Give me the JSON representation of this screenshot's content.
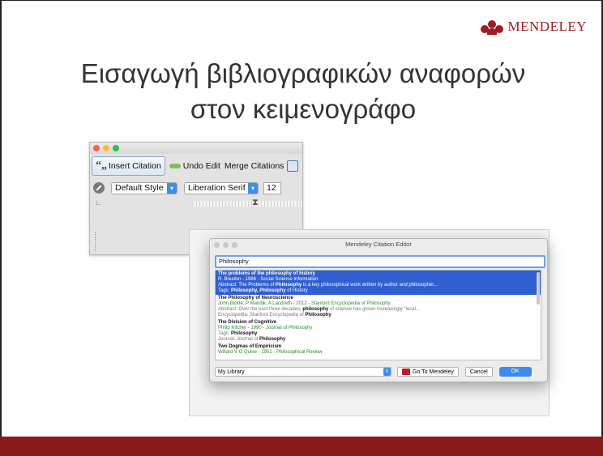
{
  "brand": {
    "name": "MENDELEY",
    "color": "#9e1c22",
    "logo_icon": "mendeley-people-icon"
  },
  "title": {
    "line1": "Εισαγωγή βιβλιογραφικών αναφορών",
    "line2": "στον κειμενογράφο"
  },
  "footer_color": "#8a1a1a",
  "word_processor": {
    "toolbar": {
      "insert_citation": "Insert Citation",
      "undo_edit": "Undo Edit",
      "merge_citations": "Merge Citations"
    },
    "style_select": "Default Style",
    "font_select": "Liberation Serif",
    "font_size": "12"
  },
  "citation_editor": {
    "window_title": "Mendeley Citation Editor",
    "search_value": "Philosophy",
    "results": [
      {
        "title": "The problems of the philosophy of history",
        "authors": "R. Boudon - 1986 - Social Science Information",
        "detail_prefix": "Abstract: The Problems of ",
        "detail_bold": "Philosophy",
        "detail_suffix": " is a key philosophical work written by author and philosopher...",
        "extra_prefix": "Tags: ",
        "extra_bold": "Philosophy, Philosophy",
        "extra_suffix": " of History",
        "selected": true
      },
      {
        "title": "The Philosophy of Neuroscience",
        "authors": "John Bickle; P Mandik; A Landreth - 2012 - Stanford Encyclopedia of Philosophy",
        "detail_prefix": "Abstract: Over the past three decades, ",
        "detail_bold": "philosophy",
        "detail_suffix": " of science has grown increasingly \"local...",
        "extra_prefix": "Encyclopedia: Stanford Encyclopedia of ",
        "extra_bold": "Philosophy",
        "extra_suffix": "",
        "selected": false
      },
      {
        "title": "The Division of Cognitive",
        "authors": "Philip Kitcher - 1990 - Journal of Philosophy",
        "detail_prefix": "Tags: ",
        "detail_bold": "Philosophy",
        "detail_suffix": "",
        "extra_prefix": "Journal: Journal of ",
        "extra_bold": "Philosophy",
        "extra_suffix": "",
        "selected": false
      },
      {
        "title": "Two Dogmas of Empiricism",
        "authors": "Willard V O Quine - 1951 - Philosophical Review",
        "detail_prefix": "",
        "detail_bold": "",
        "detail_suffix": "",
        "extra_prefix": "",
        "extra_bold": "",
        "extra_suffix": "",
        "selected": false
      }
    ],
    "library_select": "My Library",
    "go_to_mendeley": "Go To Mendeley",
    "cancel": "Cancel",
    "ok": "OK"
  }
}
